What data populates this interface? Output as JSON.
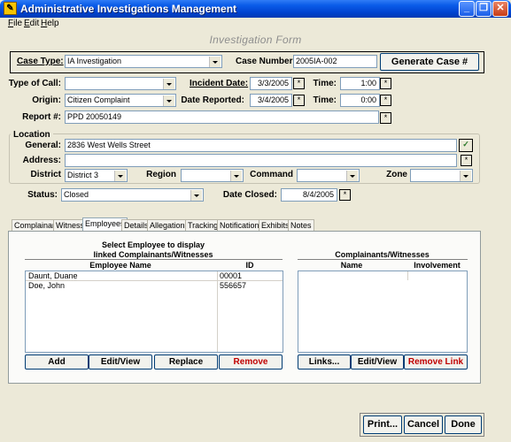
{
  "window": {
    "title": "Administrative Investigations Management",
    "icon_glyph": "✎",
    "controls": [
      "_",
      "❐",
      "✕"
    ]
  },
  "menu": [
    "File",
    "Edit",
    "Help"
  ],
  "form": {
    "title": "Investigation Form"
  },
  "case": {
    "type_label": "Case Type:",
    "type_value": "IA Investigation",
    "number_label": "Case Number:",
    "number_value": "2005IA-002",
    "generate_label": "Generate Case #"
  },
  "details": {
    "type_of_call_label": "Type of Call:",
    "type_of_call_value": "",
    "incident_date_label": "Incident Date:",
    "incident_date_value": "3/3/2005",
    "time1_label": "Time:",
    "time1_value": "1:00",
    "origin_label": "Origin:",
    "origin_value": "Citizen Complaint",
    "date_reported_label": "Date Reported:",
    "date_reported_value": "3/4/2005",
    "time2_label": "Time:",
    "time2_value": "0:00",
    "report_label": "Report #:",
    "report_value": "PPD 20050149"
  },
  "location": {
    "group_label": "Location",
    "general_label": "General:",
    "general_value": "2836 West Wells Street",
    "address_label": "Address:",
    "address_value": "",
    "district_label": "District",
    "district_value": "District 3",
    "region_label": "Region",
    "region_value": "",
    "command_label": "Command",
    "command_value": "",
    "zone_label": "Zone",
    "zone_value": ""
  },
  "status": {
    "status_label": "Status:",
    "status_value": "Closed",
    "date_closed_label": "Date Closed:",
    "date_closed_value": "8/4/2005"
  },
  "tabs": [
    "Complainant",
    "Witness",
    "Employees",
    "Details",
    "Allegations",
    "Tracking",
    "Notifications",
    "Exhibits",
    "Notes"
  ],
  "active_tab": "Employees",
  "employees": {
    "instruction_line1": "Select Employee to display",
    "instruction_line2": "linked Complainants/Witnesses",
    "col_name": "Employee Name",
    "col_id": "ID",
    "rows": [
      {
        "name": "Daunt, Duane",
        "id": "00001"
      },
      {
        "name": "Doe, John",
        "id": "556657"
      }
    ],
    "buttons": {
      "add": "Add",
      "edit": "Edit/View",
      "replace": "Replace",
      "remove": "Remove"
    }
  },
  "complainants": {
    "heading": "Complainants/Witnesses",
    "col_name": "Name",
    "col_involvement": "Involvement",
    "buttons": {
      "links": "Links...",
      "edit": "Edit/View",
      "remove_link": "Remove Link"
    }
  },
  "footer": {
    "print": "Print...",
    "cancel": "Cancel",
    "done": "Done"
  },
  "glyphs": {
    "star": "*",
    "check": "✓"
  },
  "colors": {
    "titlebar": "#0a5ce8",
    "remove_text": "#c00000",
    "face": "#ece9d8"
  }
}
